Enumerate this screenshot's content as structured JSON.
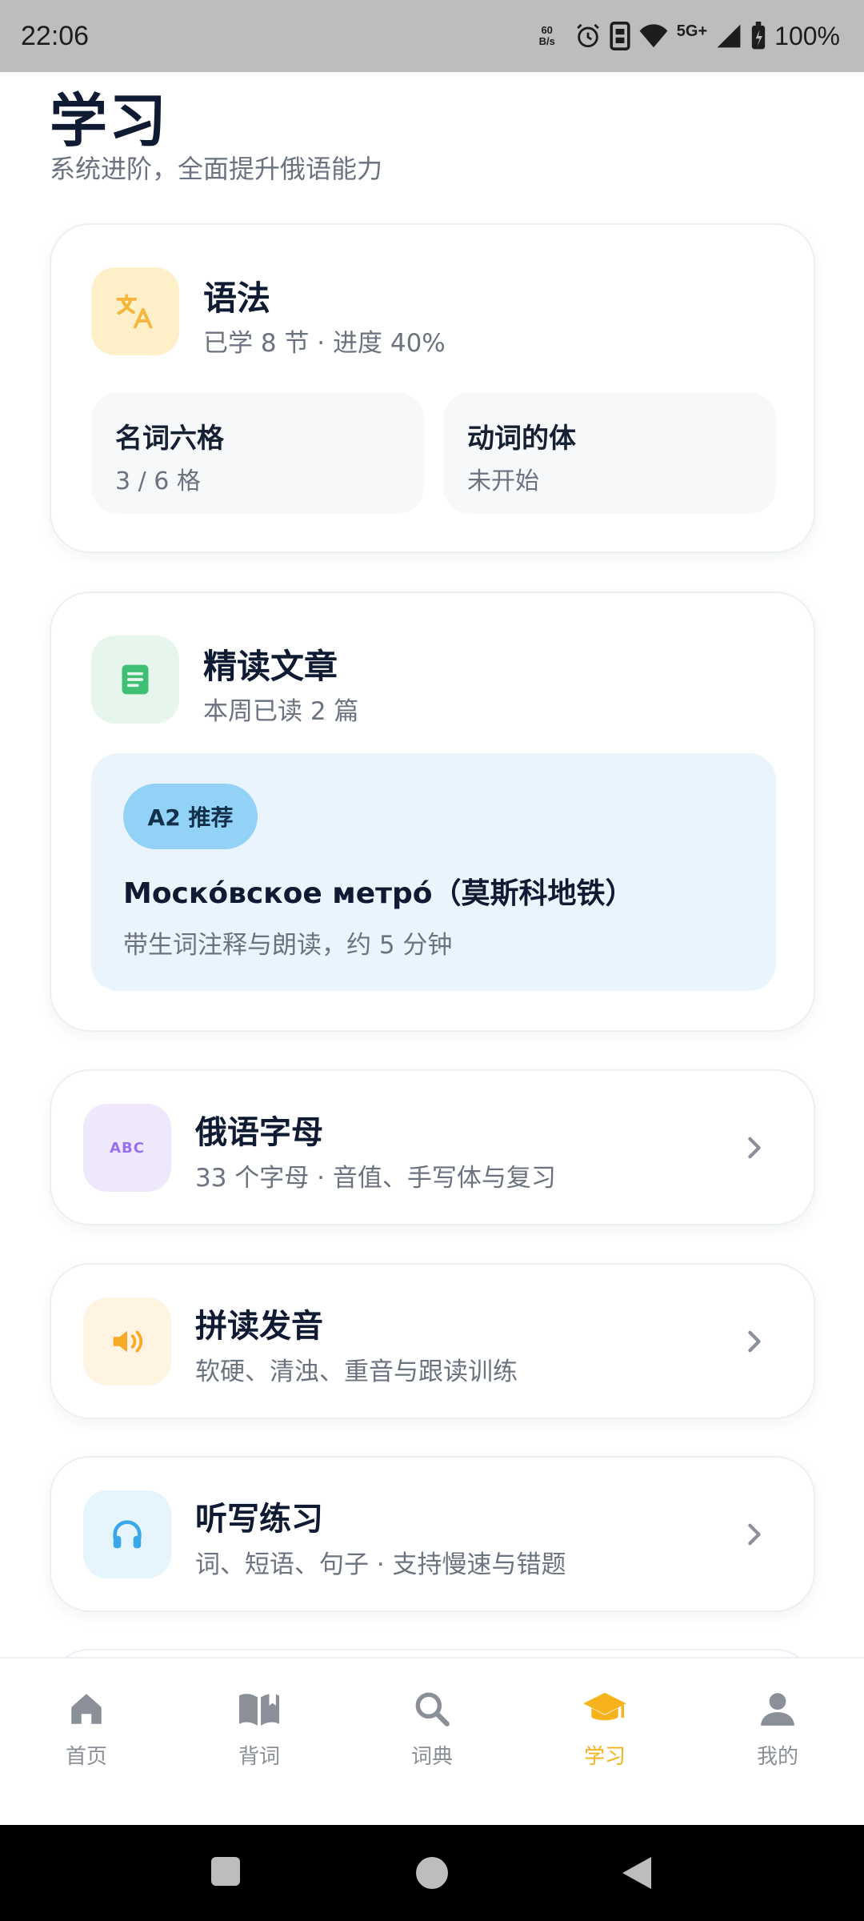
{
  "status_bar": {
    "time": "22:06",
    "net_speed_value": "60",
    "net_speed_unit": "B/s",
    "network_label": "5G+",
    "battery": "100%"
  },
  "page": {
    "title": "学习",
    "subtitle": "系统进阶，全面提升俄语能力"
  },
  "grammar_card": {
    "icon": "translate-icon",
    "title": "语法",
    "subtitle": "已学 8 节 · 进度 40%",
    "progress_percent": 40,
    "topics": [
      {
        "title": "名词六格",
        "status": "3 / 6 格"
      },
      {
        "title": "动词的体",
        "status": "未开始"
      }
    ]
  },
  "reading_card": {
    "icon": "document-icon",
    "title": "精读文章",
    "subtitle": "本周已读 2 篇",
    "article": {
      "badge": "A2 推荐",
      "title": "Москóвское метрó（莫斯科地铁）",
      "description": "带生词注释与朗读，约 5 分钟"
    }
  },
  "list_rows": [
    {
      "icon": "abc-icon",
      "title": "俄语字母",
      "subtitle": "33 个字母 · 音值、手写体与复习"
    },
    {
      "icon": "speaker-icon",
      "title": "拼读发音",
      "subtitle": "软硬、清浊、重音与跟读训练"
    },
    {
      "icon": "headphones-icon",
      "title": "听写练习",
      "subtitle": "词、短语、句子 · 支持慢速与错题"
    }
  ],
  "bottom_nav": {
    "items": [
      {
        "label": "首页",
        "icon": "home-icon"
      },
      {
        "label": "背词",
        "icon": "book-icon"
      },
      {
        "label": "词典",
        "icon": "search-icon"
      },
      {
        "label": "学习",
        "icon": "graduation-cap-icon",
        "active": true
      },
      {
        "label": "我的",
        "icon": "person-icon"
      }
    ]
  },
  "colors": {
    "accent": "#f5b21a",
    "text_primary": "#0f1a33",
    "text_secondary": "#6b7280",
    "badge_bg": "#92d2f7"
  }
}
